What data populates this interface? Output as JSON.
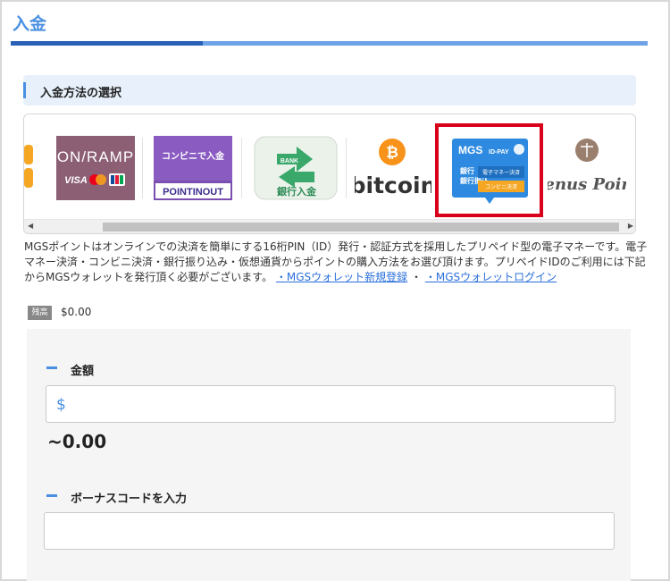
{
  "page": {
    "title": "入金"
  },
  "section": {
    "title": "入金方法の選択"
  },
  "methods": [
    {
      "name": "ON/RAMP",
      "line1": "ON/RAMP",
      "line2": "VISA",
      "line3": "JCB"
    },
    {
      "name": "コンビニで入金",
      "line1": "コンビニで入金",
      "line2": "POINTINOUT"
    },
    {
      "name": "銀行入金",
      "badge": "BANK",
      "label": "銀行入金"
    },
    {
      "name": "bitcoin",
      "label": "bitcoin"
    },
    {
      "name": "MGS ID-PAY",
      "label1": "MGS",
      "label2": "ID-PAY",
      "label3": "銀行振込",
      "label4": "電子マネー決済",
      "label5": "コンビニ決済",
      "selected": true
    },
    {
      "name": "Venus Point",
      "label": "Venus Point"
    }
  ],
  "description": {
    "text": "MGSポイントはオンラインでの決済を簡単にする16桁PIN（ID）発行・認証方式を採用したプリペイド型の電子マネーです。電子マネー決済・コンビニ決済・銀行振り込み・仮想通貨からポイントの購入方法をお選び頂けます。プリペイドIDのご利用には下記からMGSウォレットを発行頂く必要がございます。",
    "link1": "・MGSウォレット新規登録",
    "separator": "・",
    "link2": "・MGSウォレットログイン"
  },
  "balance": {
    "badge": "残高",
    "value": "$0.00"
  },
  "form": {
    "amount_label": "金額",
    "currency_symbol": "$",
    "amount_total": "~0.00",
    "bonus_label": "ボーナスコードを入力"
  },
  "colors": {
    "accent": "#4a90e2",
    "selected_border": "#d9001b",
    "bitcoin": "#f7931a"
  }
}
